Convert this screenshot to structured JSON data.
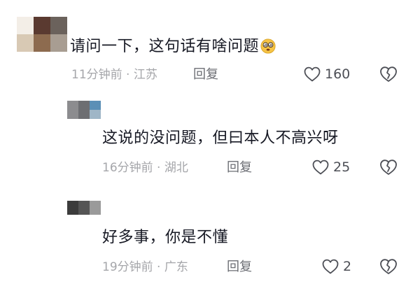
{
  "comments": [
    {
      "text": "请问一下，这句话有啥问题",
      "emoji": "dizzy-face-emoji",
      "time": "11分钟前",
      "location": "江苏",
      "reply_label": "回复",
      "likes": "160"
    },
    {
      "text": "这说的没问题，但曰本人不高兴呀",
      "time": "16分钟前",
      "location": "湖北",
      "reply_label": "回复",
      "likes": "25"
    },
    {
      "text": "好多事，你是不懂",
      "time": "19分钟前",
      "location": "广东",
      "reply_label": "回复",
      "likes": "2"
    }
  ],
  "separator": " · ",
  "colors": {
    "text": "#161823",
    "meta": "#a5a6aa",
    "icon": "#4d4f56"
  },
  "icons": {
    "like": "heart-outline-icon",
    "dislike": "broken-heart-icon"
  }
}
